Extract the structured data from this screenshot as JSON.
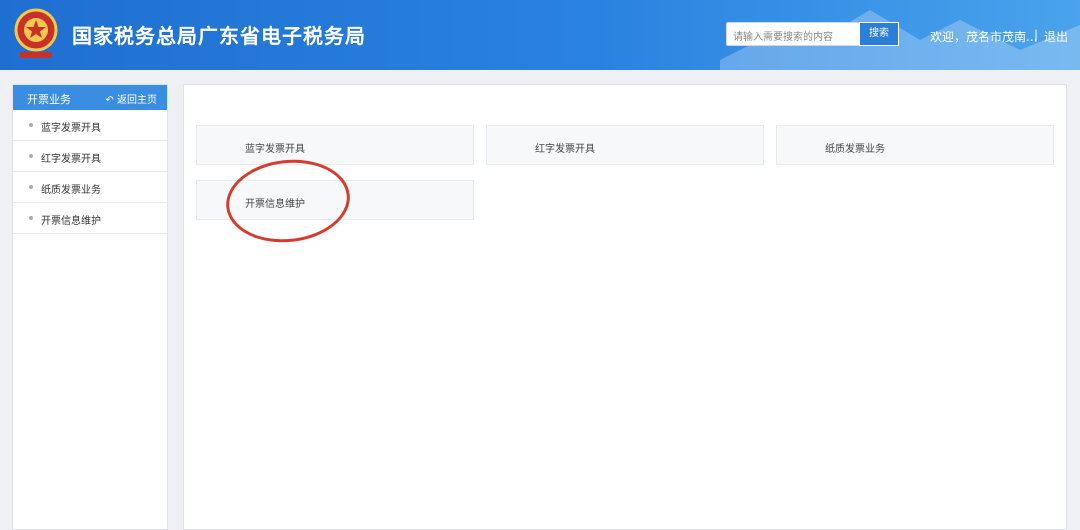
{
  "header": {
    "title": "国家税务总局广东省电子税务局",
    "search_placeholder": "请输入需要搜索的内容",
    "search_button": "搜索",
    "welcome": "欢迎，茂名市茂南...",
    "separator": "|",
    "logout": "退出"
  },
  "sidebar": {
    "heading": "开票业务",
    "back_link": "返回主页",
    "items": [
      {
        "label": "蓝字发票开具"
      },
      {
        "label": "红字发票开具"
      },
      {
        "label": "纸质发票业务"
      },
      {
        "label": "开票信息维护"
      }
    ]
  },
  "main": {
    "cards": [
      {
        "label": "蓝字发票开具"
      },
      {
        "label": "红字发票开具"
      },
      {
        "label": "纸质发票业务"
      },
      {
        "label": "开票信息维护"
      }
    ]
  },
  "colors": {
    "header_blue": "#2a82e0",
    "sidebar_head": "#3a8ee2",
    "annotation_red": "#d43d2e"
  }
}
